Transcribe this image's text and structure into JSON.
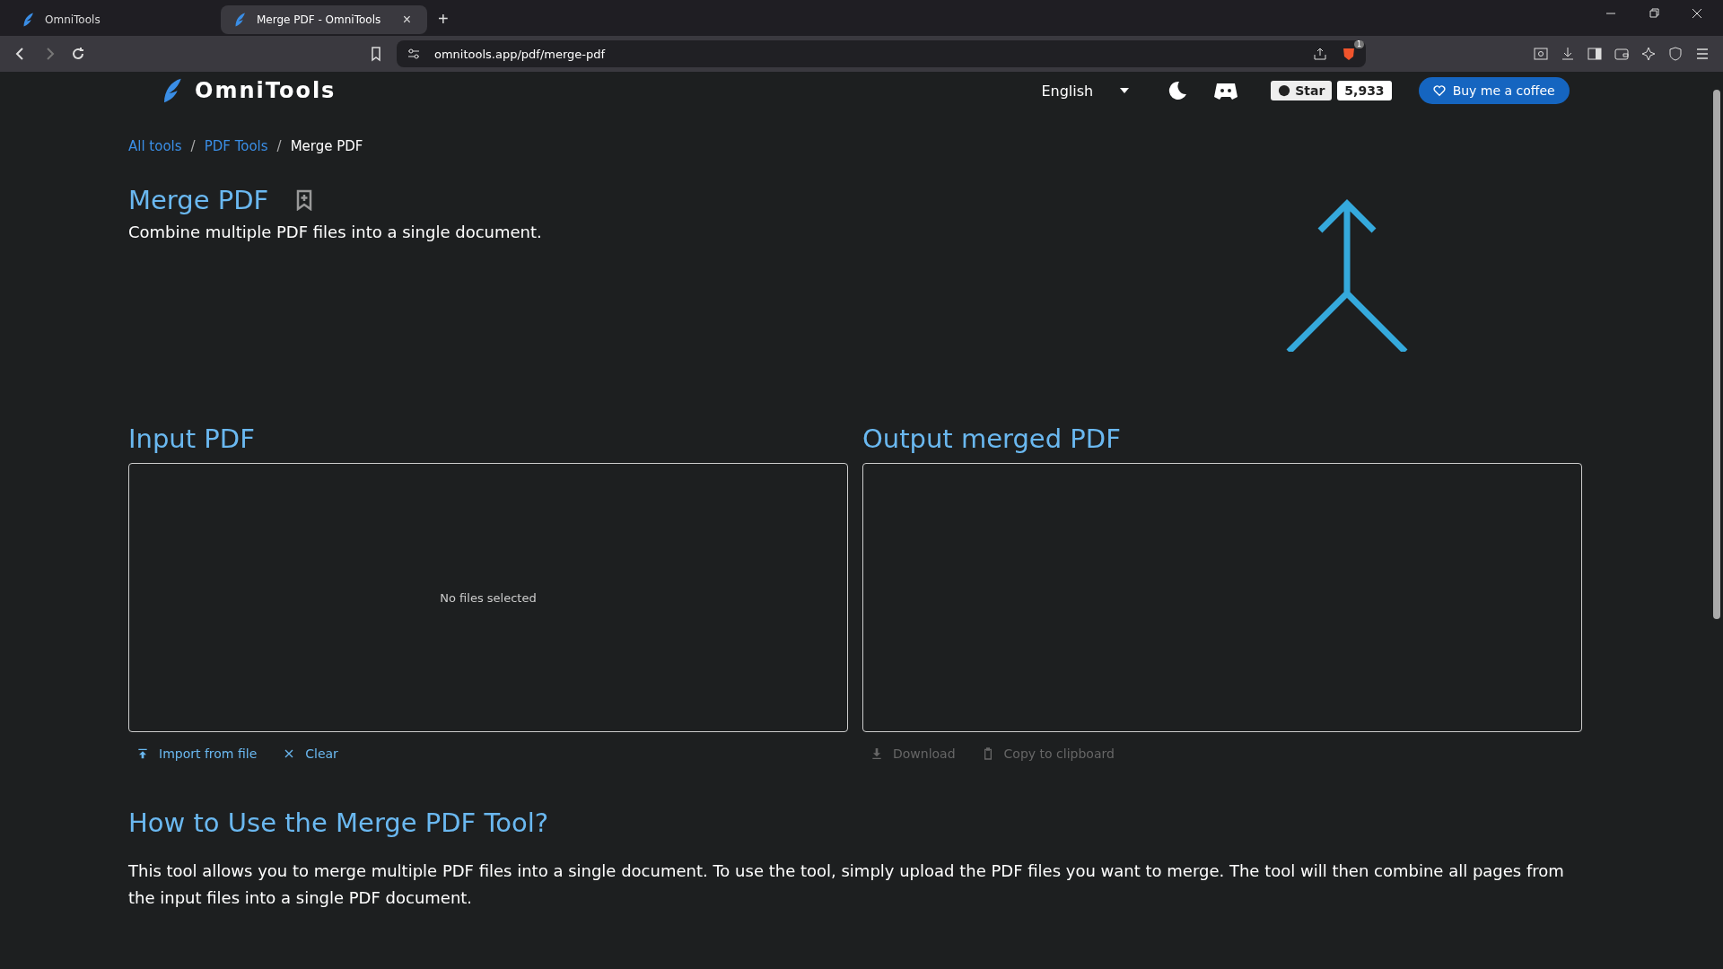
{
  "browser": {
    "tabs": [
      {
        "title": "OmniTools",
        "selected": false
      },
      {
        "title": "Merge PDF - OmniTools",
        "selected": true
      }
    ],
    "close_tab": "×",
    "new_tab": "+",
    "url": "omnitools.app/pdf/merge-pdf",
    "shield_badge": "1"
  },
  "header": {
    "logo": "OmniTools",
    "language": "English",
    "star": "Star",
    "star_count": "5,933",
    "coffee": "Buy me a coffee"
  },
  "breadcrumb": [
    {
      "label": "All tools",
      "kind": "link"
    },
    {
      "label": "PDF Tools",
      "kind": "link"
    },
    {
      "label": "Merge PDF",
      "kind": "current"
    }
  ],
  "breadcrumb_separator": "/",
  "title": "Merge PDF",
  "description": "Combine multiple PDF files into a single document.",
  "input": {
    "heading": "Input PDF",
    "empty_text": "No files selected",
    "actions": [
      {
        "label": "Import from file",
        "kind": "upload",
        "disabled": false
      },
      {
        "label": "Clear",
        "kind": "clear",
        "disabled": false
      }
    ]
  },
  "output": {
    "heading": "Output merged PDF",
    "actions": [
      {
        "label": "Download",
        "kind": "download",
        "disabled": true
      },
      {
        "label": "Copy to clipboard",
        "kind": "copy",
        "disabled": true
      }
    ]
  },
  "howto": {
    "heading": "How to Use the Merge PDF Tool?",
    "text": "This tool allows you to merge multiple PDF files into a single document. To use the tool, simply upload the PDF files you want to merge. The tool will then combine all pages from the input files into a single PDF document."
  }
}
